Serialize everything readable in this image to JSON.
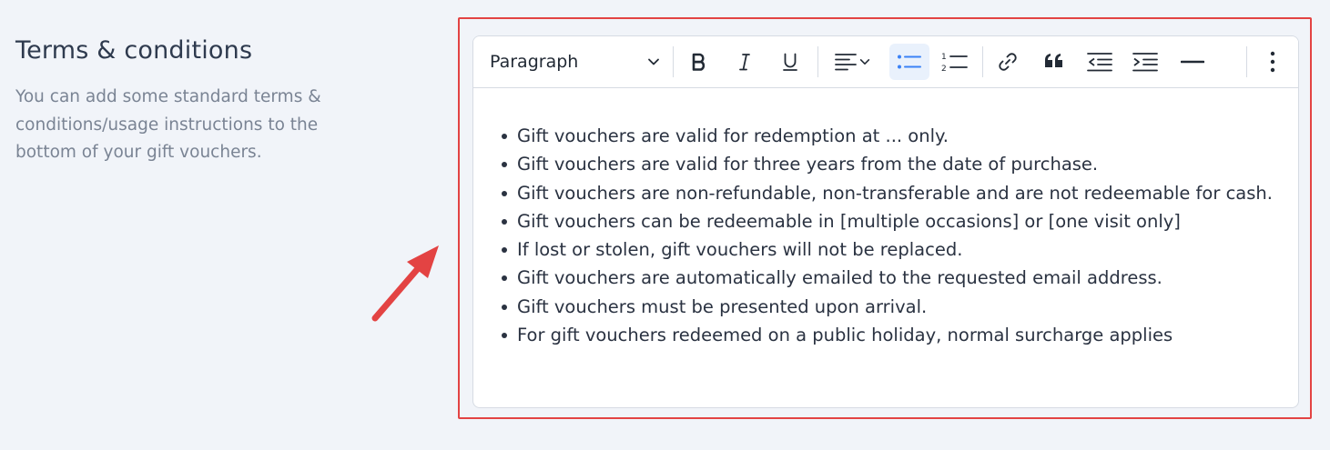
{
  "section": {
    "title": "Terms & conditions",
    "description": "You can add some standard terms & conditions/usage instructions to the bottom of your gift vouchers."
  },
  "toolbar": {
    "block_format": "Paragraph",
    "buttons": [
      {
        "name": "bold-button",
        "icon": "bold-icon"
      },
      {
        "name": "italic-button",
        "icon": "italic-icon"
      },
      {
        "name": "underline-button",
        "icon": "underline-icon"
      },
      {
        "name": "align-button",
        "icon": "align-left-icon"
      },
      {
        "name": "bulleted-list-button",
        "icon": "bulleted-list-icon",
        "active": true
      },
      {
        "name": "numbered-list-button",
        "icon": "numbered-list-icon"
      },
      {
        "name": "link-button",
        "icon": "link-icon"
      },
      {
        "name": "blockquote-button",
        "icon": "quote-icon"
      },
      {
        "name": "outdent-button",
        "icon": "outdent-icon"
      },
      {
        "name": "indent-button",
        "icon": "indent-icon"
      },
      {
        "name": "horizontal-line-button",
        "icon": "horizontal-line-icon"
      },
      {
        "name": "more-button",
        "icon": "more-vertical-icon"
      }
    ]
  },
  "editor": {
    "items": [
      "Gift vouchers are valid for redemption at ... only.",
      "Gift vouchers are valid for three years from the date of purchase.",
      "Gift vouchers are non-refundable, non-transferable and are not redeemable for cash.",
      "Gift vouchers can be redeemable in [multiple occasions] or [one visit only]",
      "If lost or stolen, gift vouchers will not be replaced.",
      "Gift vouchers are automatically emailed to the requested email address.",
      "Gift vouchers must be presented upon arrival.",
      "For gift vouchers redeemed on a public holiday, normal surcharge applies"
    ]
  },
  "colors": {
    "highlight": "#e34343",
    "active_button_bg": "#e9f1fc",
    "accent": "#3b82f6"
  }
}
